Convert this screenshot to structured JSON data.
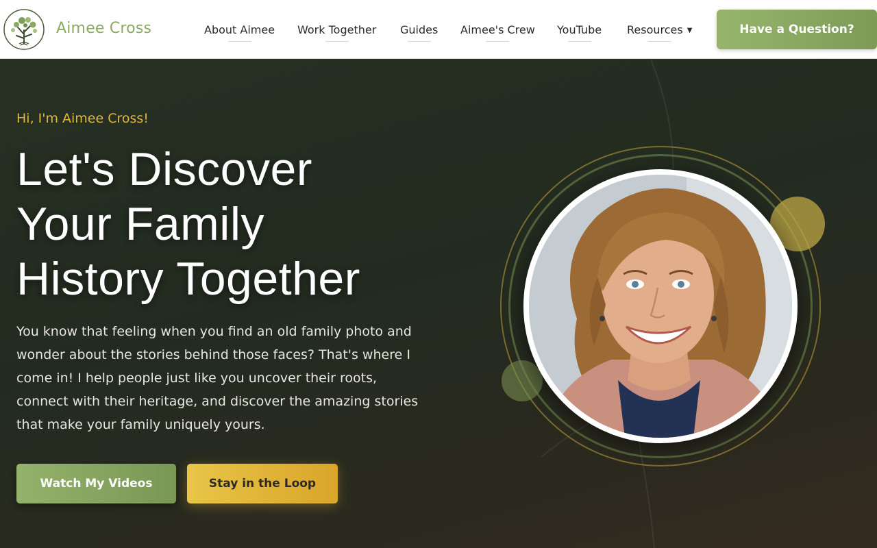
{
  "brand": {
    "name": "Aimee Cross",
    "accent": "#8aa961",
    "gold": "#e0b73c",
    "logo_icon": "tree-logo-icon"
  },
  "nav": {
    "items": [
      {
        "label": "About Aimee",
        "dropdown": false
      },
      {
        "label": "Work Together",
        "dropdown": false
      },
      {
        "label": "Guides",
        "dropdown": false
      },
      {
        "label": "Aimee's Crew",
        "dropdown": false
      },
      {
        "label": "YouTube",
        "dropdown": false
      },
      {
        "label": "Resources",
        "dropdown": true,
        "dropdown_icon": "caret-down-icon"
      }
    ],
    "cta_label": "Have a Question?"
  },
  "hero": {
    "eyebrow": "Hi, I'm Aimee Cross!",
    "headline_lines": [
      "Let's Discover",
      "Your Family",
      "History Together"
    ],
    "intro": "You know that feeling when you find an old family photo and wonder about the stories behind those faces? That's where I come in! I help people just like you uncover their roots, connect with their heritage, and discover the amazing stories that make your family uniquely yours.",
    "buttons": {
      "videos_label": "Watch My Videos",
      "loop_label": "Stay in the Loop"
    },
    "portrait_alt": "Portrait of Aimee Cross"
  }
}
